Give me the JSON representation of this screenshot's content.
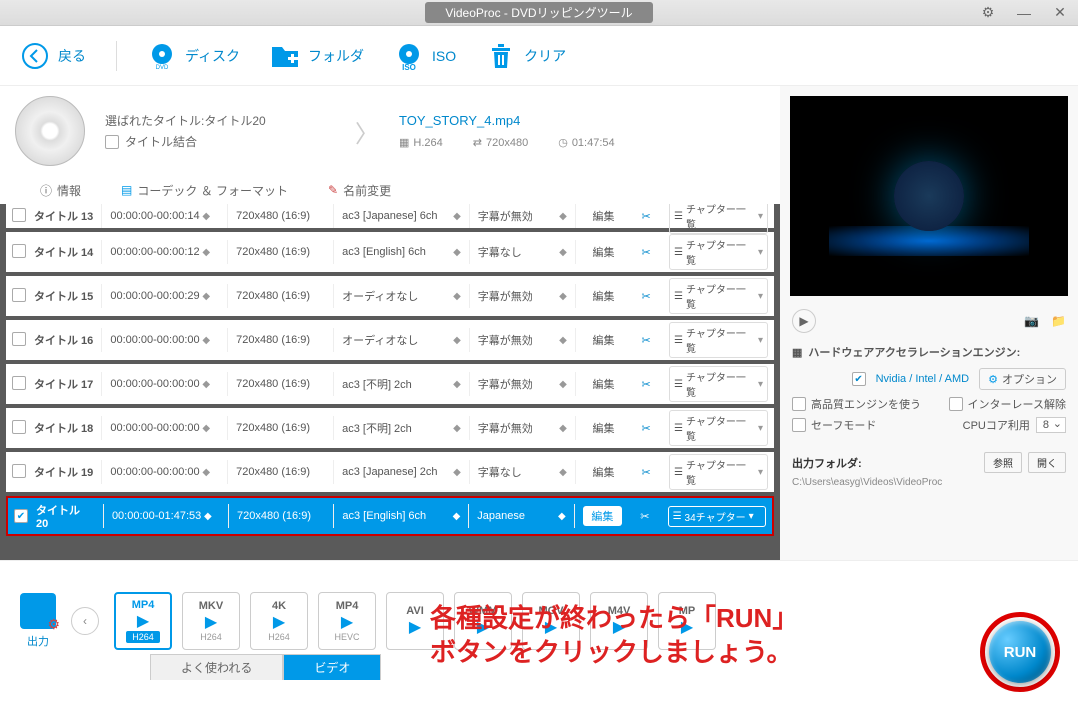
{
  "titlebar": "VideoProc - DVDリッピングツール",
  "toolbar": {
    "back": "戻る",
    "disk": "ディスク",
    "folder": "フォルダ",
    "iso": "ISO",
    "clear": "クリア"
  },
  "info": {
    "selected": "選ばれたタイトル:タイトル20",
    "merge": "タイトル結合",
    "filename": "TOY_STORY_4.mp4",
    "codec": "H.264",
    "res": "720x480",
    "dur": "01:47:54"
  },
  "tabs": {
    "info": "情報",
    "codec": "コーデック ＆ フォーマット",
    "rename": "名前変更"
  },
  "rows": [
    {
      "title": "タイトル 13",
      "time": "00:00:00-00:00:14",
      "res": "720x480 (16:9)",
      "audio": "ac3 [Japanese] 6ch",
      "sub": "字幕が無効",
      "edit": "編集",
      "chap": "チャプター一覧",
      "sel": false,
      "first": true
    },
    {
      "title": "タイトル 14",
      "time": "00:00:00-00:00:12",
      "res": "720x480 (16:9)",
      "audio": "ac3 [English] 6ch",
      "sub": "字幕なし",
      "edit": "編集",
      "chap": "チャプター一覧",
      "sel": false
    },
    {
      "title": "タイトル 15",
      "time": "00:00:00-00:00:29",
      "res": "720x480 (16:9)",
      "audio": "オーディオなし",
      "sub": "字幕が無効",
      "edit": "編集",
      "chap": "チャプター一覧",
      "sel": false
    },
    {
      "title": "タイトル 16",
      "time": "00:00:00-00:00:00",
      "res": "720x480 (16:9)",
      "audio": "オーディオなし",
      "sub": "字幕が無効",
      "edit": "編集",
      "chap": "チャプター一覧",
      "sel": false
    },
    {
      "title": "タイトル 17",
      "time": "00:00:00-00:00:00",
      "res": "720x480 (16:9)",
      "audio": "ac3 [不明] 2ch",
      "sub": "字幕が無効",
      "edit": "編集",
      "chap": "チャプター一覧",
      "sel": false
    },
    {
      "title": "タイトル 18",
      "time": "00:00:00-00:00:00",
      "res": "720x480 (16:9)",
      "audio": "ac3 [不明] 2ch",
      "sub": "字幕が無効",
      "edit": "編集",
      "chap": "チャプター一覧",
      "sel": false
    },
    {
      "title": "タイトル 19",
      "time": "00:00:00-00:00:00",
      "res": "720x480 (16:9)",
      "audio": "ac3 [Japanese] 2ch",
      "sub": "字幕なし",
      "edit": "編集",
      "chap": "チャプター一覧",
      "sel": false
    },
    {
      "title": "タイトル 20",
      "time": "00:00:00-01:47:53",
      "res": "720x480 (16:9)",
      "audio": "ac3 [English] 6ch",
      "sub": "Japanese",
      "edit": "編集",
      "chap": "34チャプター",
      "sel": true
    }
  ],
  "hw": {
    "title": "ハードウェアアクセラレーションエンジン:",
    "gpu": "Nvidia / Intel / AMD",
    "options": "オプション",
    "hq": "高品質エンジンを使う",
    "deint": "インターレース解除",
    "safe": "セーフモード",
    "cpu": "CPUコア利用",
    "cpu_val": "8"
  },
  "folder": {
    "label": "出力フォルダ:",
    "browse": "参照",
    "open": "開く",
    "path": "C:\\Users\\easyg\\Videos\\VideoProc"
  },
  "output_label": "出力",
  "formats": [
    {
      "top": "MP4",
      "bot": "H264",
      "sel": true
    },
    {
      "top": "MKV",
      "bot": "H264"
    },
    {
      "top": "4K",
      "bot": "H264"
    },
    {
      "top": "MP4",
      "bot": "HEVC"
    },
    {
      "top": "AVI",
      "bot": ""
    },
    {
      "top": "WMM",
      "bot": ""
    },
    {
      "top": "MOV",
      "bot": ""
    },
    {
      "top": "M4V",
      "bot": ""
    },
    {
      "top": "MP",
      "bot": ""
    }
  ],
  "bottom_tabs": {
    "freq": "よく使われる",
    "video": "ビデオ"
  },
  "annotation_l1": "各種設定が終わったら「RUN」",
  "annotation_l2": "ボタンをクリックしましょう。",
  "run": "RUN"
}
